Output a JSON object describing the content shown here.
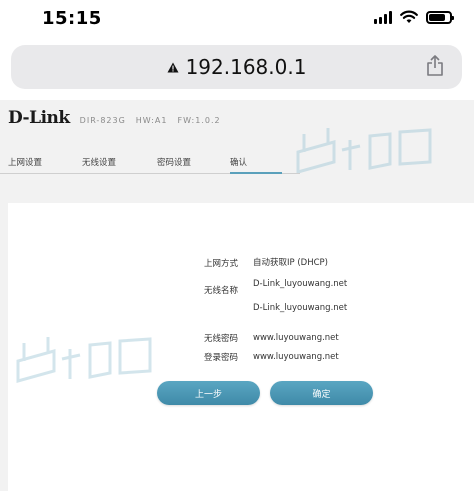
{
  "status_bar": {
    "time": "15:15"
  },
  "browser": {
    "url": "192.168.0.1"
  },
  "router": {
    "logo": "D-Link",
    "model": "DIR-823G",
    "hw": "HW:A1",
    "fw": "FW:1.0.2",
    "tabs": [
      {
        "label": "上网设置"
      },
      {
        "label": "无线设置"
      },
      {
        "label": "密码设置"
      },
      {
        "label": "确认"
      }
    ],
    "active_tab": "确认",
    "summary": {
      "connection_type_label": "上网方式",
      "connection_type_value": "自动获取IP (DHCP)",
      "wifi_name_label": "无线名称",
      "wifi_name_value_1": "D-Link_luyouwang.net",
      "wifi_name_value_2": "D-Link_luyouwang.net",
      "wifi_password_label": "无线密码",
      "wifi_password_value": "www.luyouwang.net",
      "login_password_label": "登录密码",
      "login_password_value": "www.luyouwang.net"
    },
    "buttons": {
      "prev": "上一步",
      "confirm": "确定"
    }
  },
  "colors": {
    "accent": "#4a97b5",
    "page_bg": "#f2f2f2",
    "url_bar_bg": "#e9e9eb"
  }
}
